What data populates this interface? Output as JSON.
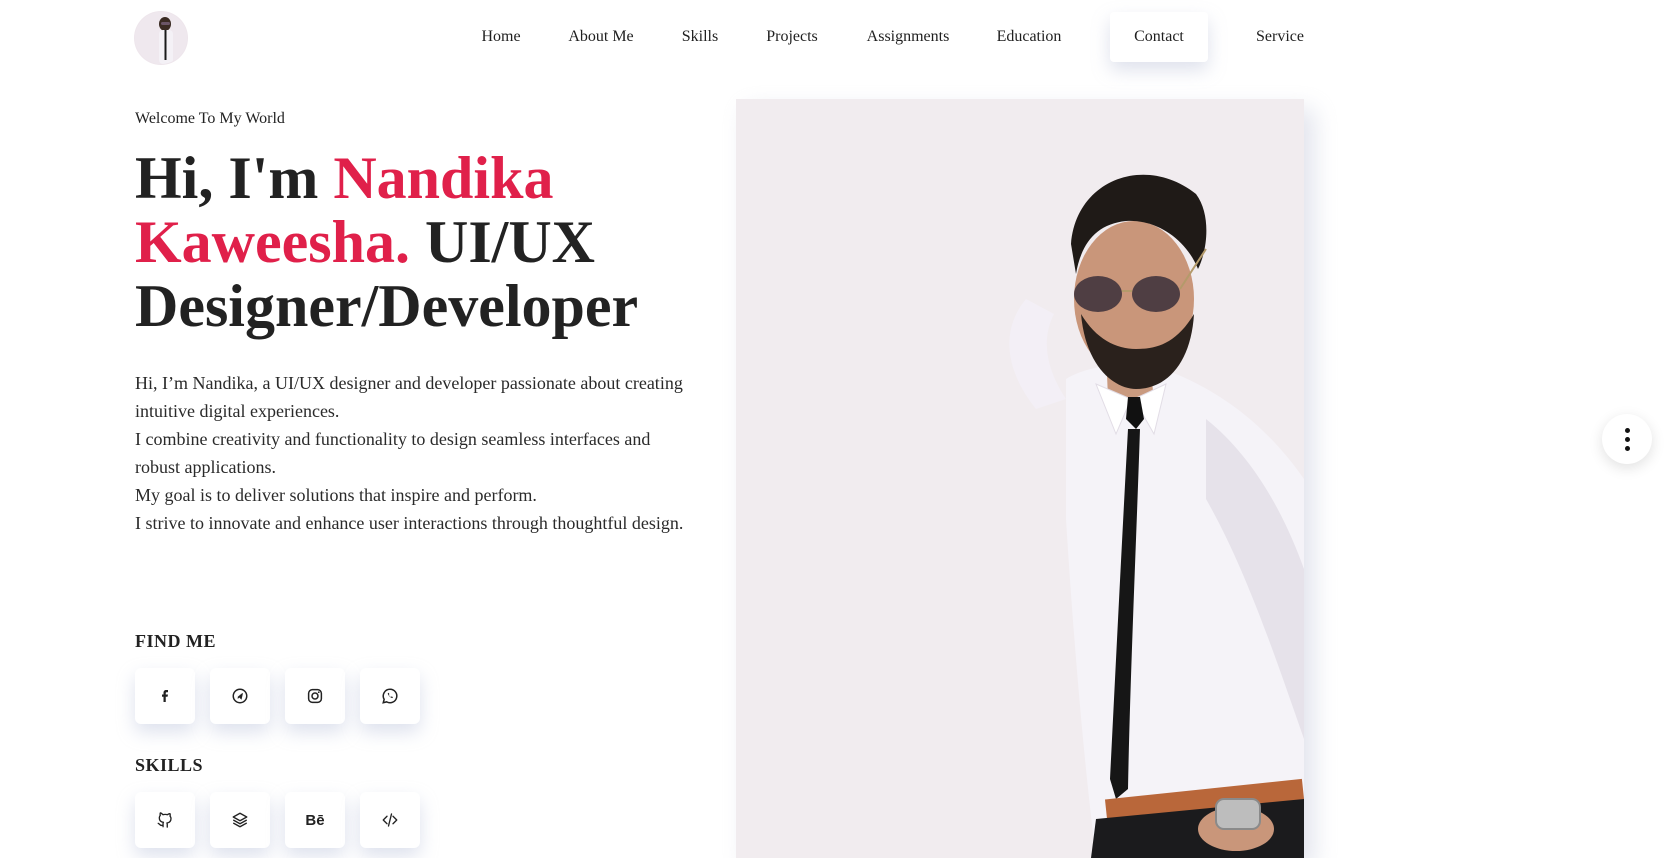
{
  "nav": {
    "avatar_icon": "profile-photo",
    "items": [
      {
        "label": "Home"
      },
      {
        "label": "About Me"
      },
      {
        "label": "Skills"
      },
      {
        "label": "Projects"
      },
      {
        "label": "Assignments"
      },
      {
        "label": "Education"
      },
      {
        "label": "Contact",
        "active": true
      },
      {
        "label": "Service"
      }
    ]
  },
  "hero": {
    "welcome": "Welcome To My World",
    "title_prefix": "Hi, I'm ",
    "title_name": "Nandika Kaweesha.",
    "title_suffix": " UI/UX Designer/Developer",
    "intro": [
      "Hi, I’m Nandika, a UI/UX designer and developer passionate about creating intuitive digital experiences.",
      "I combine creativity and functionality to design seamless interfaces and robust applications.",
      "My goal is to deliver solutions that inspire and perform.",
      "I strive to innovate and enhance user interactions through thoughtful design."
    ],
    "accent_color": "#e0204a"
  },
  "find_me": {
    "label": "FIND ME",
    "icons": [
      "facebook-icon",
      "telegram-icon",
      "instagram-icon",
      "whatsapp-icon"
    ]
  },
  "skills": {
    "label": "SKILLS",
    "icons": [
      "github-icon",
      "layers-icon",
      "behance-icon",
      "code-icon"
    ],
    "behance_text": "Bē"
  },
  "photo": {
    "icon": "portrait-photo"
  },
  "fab": {
    "icon": "more-vertical-icon"
  }
}
